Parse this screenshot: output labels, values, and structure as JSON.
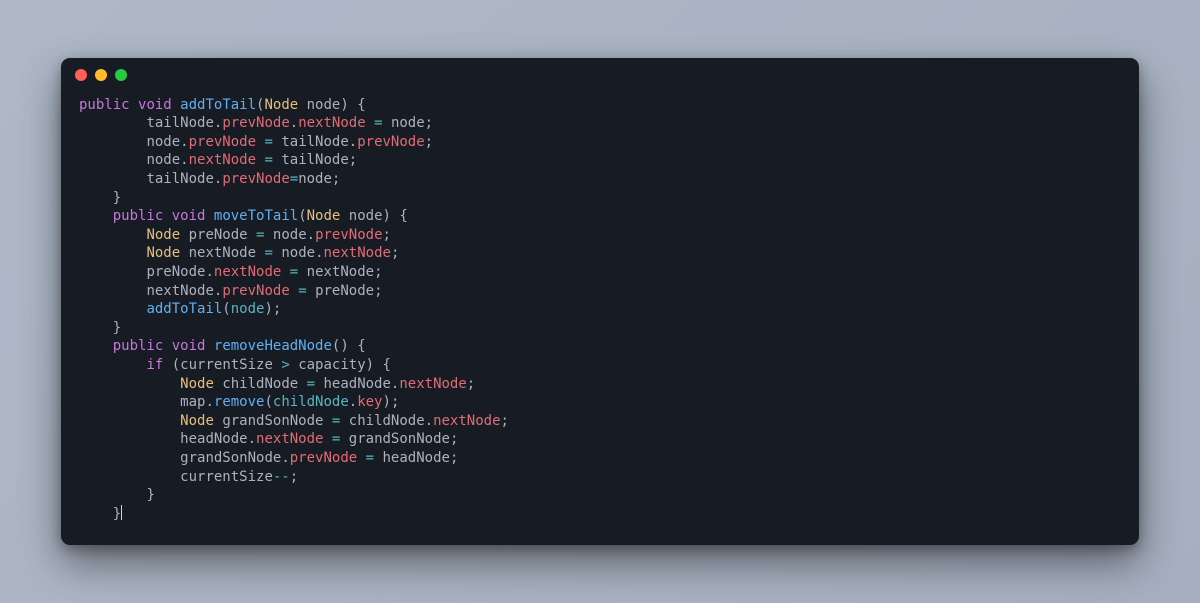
{
  "window": {
    "dots": [
      "red",
      "yellow",
      "green"
    ]
  },
  "code": {
    "lang": "java",
    "lines": [
      [
        [
          "kw",
          "public"
        ],
        [
          "sp",
          " "
        ],
        [
          "kw",
          "void"
        ],
        [
          "sp",
          " "
        ],
        [
          "fn",
          "addToTail"
        ],
        [
          "p",
          "("
        ],
        [
          "typ",
          "Node"
        ],
        [
          "sp",
          " "
        ],
        [
          "var",
          "node"
        ],
        [
          "p",
          ")"
        ],
        [
          "sp",
          " "
        ],
        [
          "p",
          "{"
        ]
      ],
      [
        [
          "sp",
          "        "
        ],
        [
          "var",
          "tailNode"
        ],
        [
          "p",
          "."
        ],
        [
          "fld",
          "prevNode"
        ],
        [
          "p",
          "."
        ],
        [
          "fld",
          "nextNode"
        ],
        [
          "sp",
          " "
        ],
        [
          "op",
          "="
        ],
        [
          "sp",
          " "
        ],
        [
          "var",
          "node"
        ],
        [
          "p",
          ";"
        ]
      ],
      [
        [
          "sp",
          "        "
        ],
        [
          "var",
          "node"
        ],
        [
          "p",
          "."
        ],
        [
          "fld",
          "prevNode"
        ],
        [
          "sp",
          " "
        ],
        [
          "op",
          "="
        ],
        [
          "sp",
          " "
        ],
        [
          "var",
          "tailNode"
        ],
        [
          "p",
          "."
        ],
        [
          "fld",
          "prevNode"
        ],
        [
          "p",
          ";"
        ]
      ],
      [
        [
          "sp",
          "        "
        ],
        [
          "var",
          "node"
        ],
        [
          "p",
          "."
        ],
        [
          "fld",
          "nextNode"
        ],
        [
          "sp",
          " "
        ],
        [
          "op",
          "="
        ],
        [
          "sp",
          " "
        ],
        [
          "var",
          "tailNode"
        ],
        [
          "p",
          ";"
        ]
      ],
      [
        [
          "sp",
          "        "
        ],
        [
          "var",
          "tailNode"
        ],
        [
          "p",
          "."
        ],
        [
          "fld",
          "prevNode"
        ],
        [
          "op",
          "="
        ],
        [
          "var",
          "node"
        ],
        [
          "p",
          ";"
        ]
      ],
      [
        [
          "sp",
          "    "
        ],
        [
          "p",
          "}"
        ]
      ],
      [
        [
          "sp",
          "    "
        ],
        [
          "kw",
          "public"
        ],
        [
          "sp",
          " "
        ],
        [
          "kw",
          "void"
        ],
        [
          "sp",
          " "
        ],
        [
          "fn",
          "moveToTail"
        ],
        [
          "p",
          "("
        ],
        [
          "typ",
          "Node"
        ],
        [
          "sp",
          " "
        ],
        [
          "var",
          "node"
        ],
        [
          "p",
          ")"
        ],
        [
          "sp",
          " "
        ],
        [
          "p",
          "{"
        ]
      ],
      [
        [
          "sp",
          "        "
        ],
        [
          "typ",
          "Node"
        ],
        [
          "sp",
          " "
        ],
        [
          "var",
          "preNode"
        ],
        [
          "sp",
          " "
        ],
        [
          "op",
          "="
        ],
        [
          "sp",
          " "
        ],
        [
          "var",
          "node"
        ],
        [
          "p",
          "."
        ],
        [
          "fld",
          "prevNode"
        ],
        [
          "p",
          ";"
        ]
      ],
      [
        [
          "sp",
          "        "
        ],
        [
          "typ",
          "Node"
        ],
        [
          "sp",
          " "
        ],
        [
          "var",
          "nextNode"
        ],
        [
          "sp",
          " "
        ],
        [
          "op",
          "="
        ],
        [
          "sp",
          " "
        ],
        [
          "var",
          "node"
        ],
        [
          "p",
          "."
        ],
        [
          "fld",
          "nextNode"
        ],
        [
          "p",
          ";"
        ]
      ],
      [
        [
          "sp",
          "        "
        ],
        [
          "var",
          "preNode"
        ],
        [
          "p",
          "."
        ],
        [
          "fld",
          "nextNode"
        ],
        [
          "sp",
          " "
        ],
        [
          "op",
          "="
        ],
        [
          "sp",
          " "
        ],
        [
          "var",
          "nextNode"
        ],
        [
          "p",
          ";"
        ]
      ],
      [
        [
          "sp",
          "        "
        ],
        [
          "var",
          "nextNode"
        ],
        [
          "p",
          "."
        ],
        [
          "fld",
          "prevNode"
        ],
        [
          "sp",
          " "
        ],
        [
          "op",
          "="
        ],
        [
          "sp",
          " "
        ],
        [
          "var",
          "preNode"
        ],
        [
          "p",
          ";"
        ]
      ],
      [
        [
          "sp",
          "        "
        ],
        [
          "fn",
          "addToTail"
        ],
        [
          "p",
          "("
        ],
        [
          "prm",
          "node"
        ],
        [
          "p",
          ")"
        ],
        [
          "p",
          ";"
        ]
      ],
      [
        [
          "sp",
          "    "
        ],
        [
          "p",
          "}"
        ]
      ],
      [
        [
          "sp",
          "    "
        ],
        [
          "kw",
          "public"
        ],
        [
          "sp",
          " "
        ],
        [
          "kw",
          "void"
        ],
        [
          "sp",
          " "
        ],
        [
          "fn",
          "removeHeadNode"
        ],
        [
          "p",
          "("
        ],
        [
          "p",
          ")"
        ],
        [
          "sp",
          " "
        ],
        [
          "p",
          "{"
        ]
      ],
      [
        [
          "sp",
          "        "
        ],
        [
          "kw",
          "if"
        ],
        [
          "sp",
          " "
        ],
        [
          "p",
          "("
        ],
        [
          "var",
          "currentSize"
        ],
        [
          "sp",
          " "
        ],
        [
          "op",
          ">"
        ],
        [
          "sp",
          " "
        ],
        [
          "var",
          "capacity"
        ],
        [
          "p",
          ")"
        ],
        [
          "sp",
          " "
        ],
        [
          "p",
          "{"
        ]
      ],
      [
        [
          "sp",
          "            "
        ],
        [
          "typ",
          "Node"
        ],
        [
          "sp",
          " "
        ],
        [
          "var",
          "childNode"
        ],
        [
          "sp",
          " "
        ],
        [
          "op",
          "="
        ],
        [
          "sp",
          " "
        ],
        [
          "var",
          "headNode"
        ],
        [
          "p",
          "."
        ],
        [
          "fld",
          "nextNode"
        ],
        [
          "p",
          ";"
        ]
      ],
      [
        [
          "sp",
          "            "
        ],
        [
          "var",
          "map"
        ],
        [
          "p",
          "."
        ],
        [
          "fn",
          "remove"
        ],
        [
          "p",
          "("
        ],
        [
          "prm",
          "childNode"
        ],
        [
          "p",
          "."
        ],
        [
          "fld",
          "key"
        ],
        [
          "p",
          ")"
        ],
        [
          "p",
          ";"
        ]
      ],
      [
        [
          "sp",
          "            "
        ],
        [
          "typ",
          "Node"
        ],
        [
          "sp",
          " "
        ],
        [
          "var",
          "grandSonNode"
        ],
        [
          "sp",
          " "
        ],
        [
          "op",
          "="
        ],
        [
          "sp",
          " "
        ],
        [
          "var",
          "childNode"
        ],
        [
          "p",
          "."
        ],
        [
          "fld",
          "nextNode"
        ],
        [
          "p",
          ";"
        ]
      ],
      [
        [
          "sp",
          "            "
        ],
        [
          "var",
          "headNode"
        ],
        [
          "p",
          "."
        ],
        [
          "fld",
          "nextNode"
        ],
        [
          "sp",
          " "
        ],
        [
          "op",
          "="
        ],
        [
          "sp",
          " "
        ],
        [
          "var",
          "grandSonNode"
        ],
        [
          "p",
          ";"
        ]
      ],
      [
        [
          "sp",
          "            "
        ],
        [
          "var",
          "grandSonNode"
        ],
        [
          "p",
          "."
        ],
        [
          "fld",
          "prevNode"
        ],
        [
          "sp",
          " "
        ],
        [
          "op",
          "="
        ],
        [
          "sp",
          " "
        ],
        [
          "var",
          "headNode"
        ],
        [
          "p",
          ";"
        ]
      ],
      [
        [
          "sp",
          "            "
        ],
        [
          "var",
          "currentSize"
        ],
        [
          "op",
          "--"
        ],
        [
          "p",
          ";"
        ]
      ],
      [
        [
          "sp",
          "        "
        ],
        [
          "p",
          "}"
        ]
      ],
      [
        [
          "sp",
          "    "
        ],
        [
          "p",
          "}"
        ],
        [
          "cursor",
          ""
        ]
      ]
    ]
  }
}
